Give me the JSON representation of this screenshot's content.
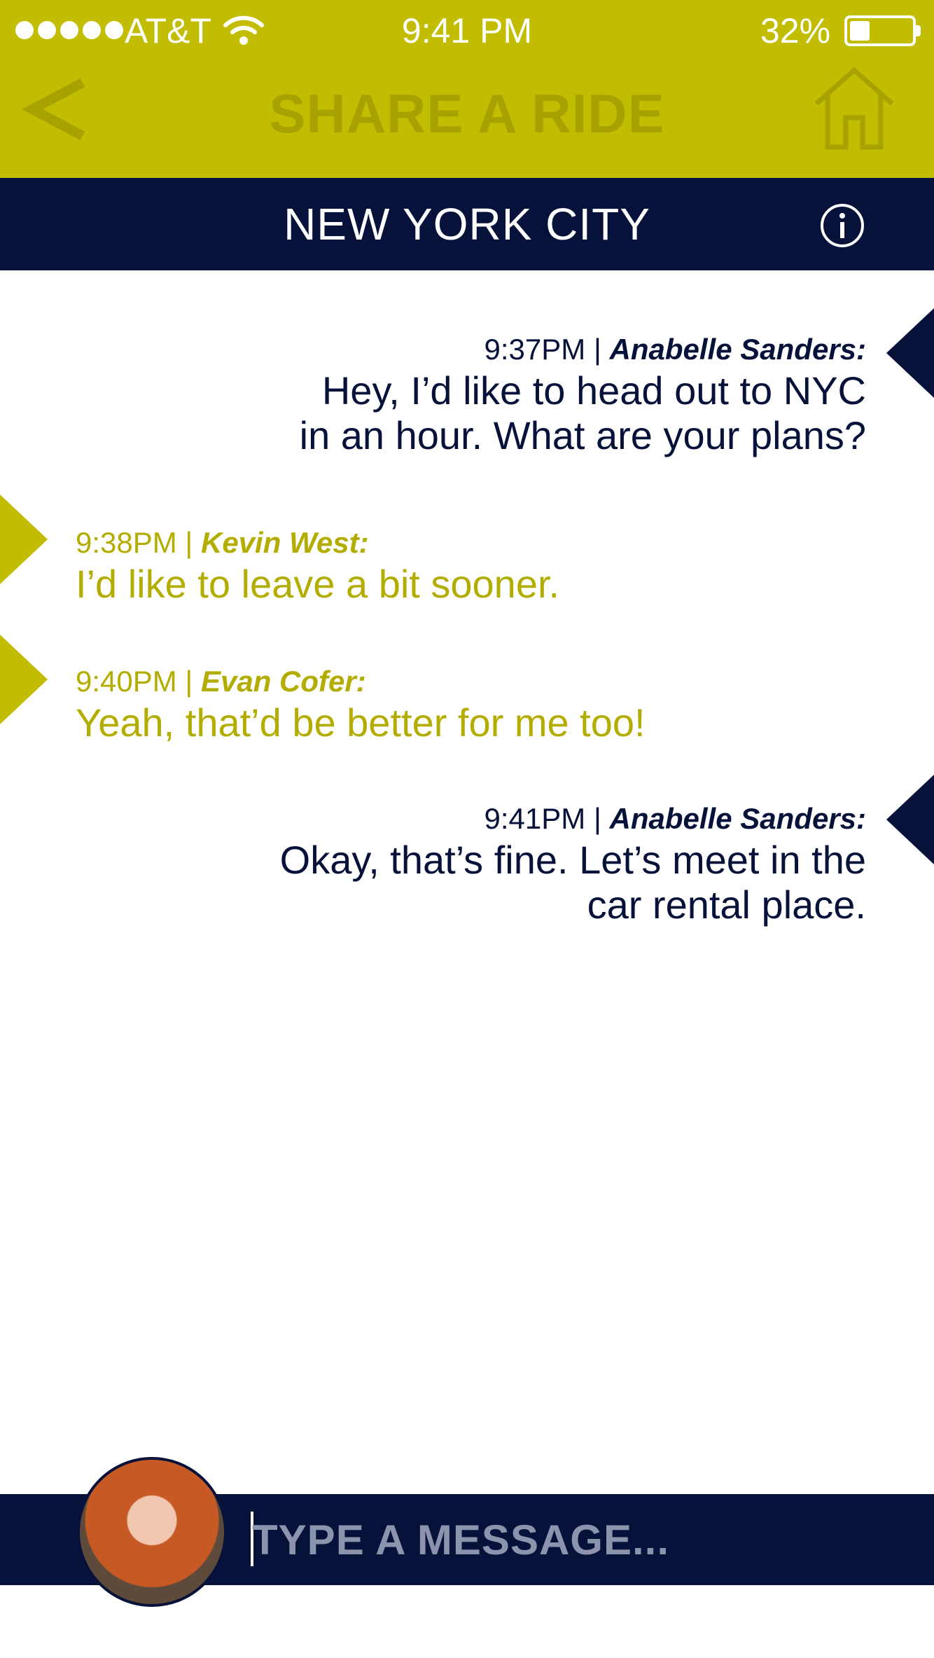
{
  "status_bar": {
    "carrier": "AT&T",
    "time": "9:41 PM",
    "battery_percent": "32%",
    "battery_level": 0.32
  },
  "header": {
    "title": "SHARE A RIDE",
    "back_icon": "chevron-left-icon",
    "home_icon": "home-icon"
  },
  "subheader": {
    "city": "NEW YORK CITY",
    "info_icon": "info-icon"
  },
  "messages": [
    {
      "time": "9:37PM |",
      "sender": "Anabelle Sanders:",
      "lines": [
        "Hey, I’d like to head out to NYC",
        "in an hour. What are your plans?"
      ],
      "side": "right"
    },
    {
      "time": "9:38PM |",
      "sender": "Kevin West:",
      "lines": [
        "I’d like to leave a bit sooner."
      ],
      "side": "left"
    },
    {
      "time": "9:40PM |",
      "sender": "Evan Cofer:",
      "lines": [
        "Yeah, that’d be better for me too!"
      ],
      "side": "left"
    },
    {
      "time": "9:41PM |",
      "sender": "Anabelle Sanders:",
      "lines": [
        "Okay, that’s fine. Let’s meet in the",
        "car rental place."
      ],
      "side": "right"
    }
  ],
  "composer": {
    "placeholder": "TYPE A MESSAGE...",
    "value": ""
  },
  "colors": {
    "brand_olive": "#c2bd00",
    "navy": "#07123b",
    "olive_text": "#b2ad00"
  }
}
